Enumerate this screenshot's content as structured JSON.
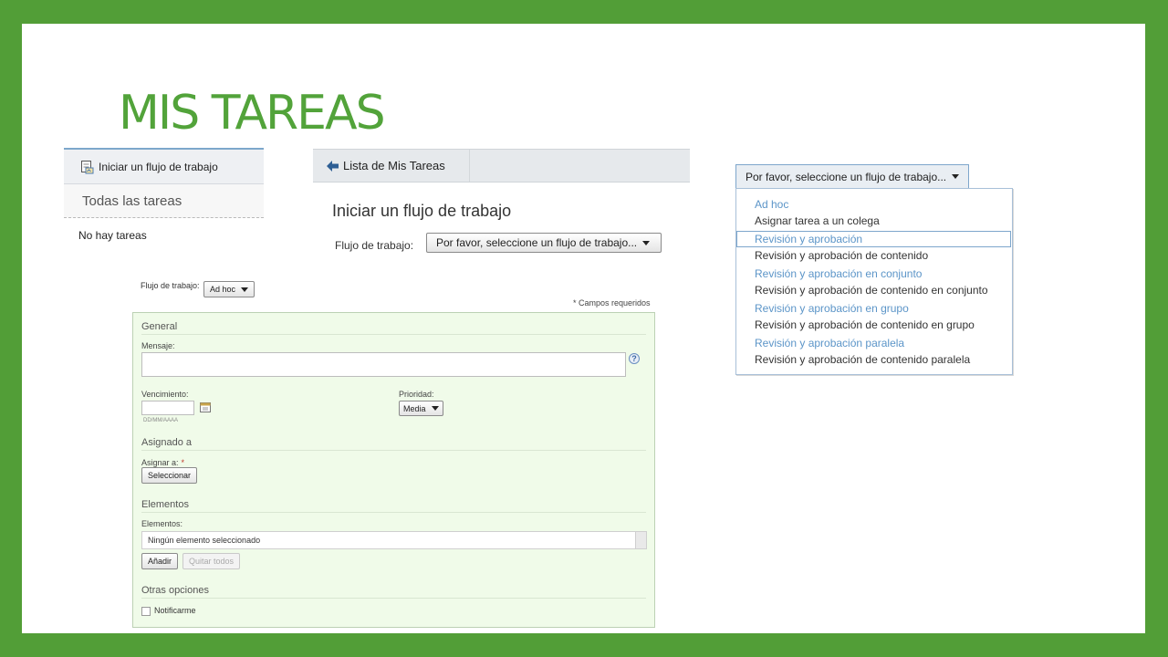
{
  "slide": {
    "title": "MIS TAREAS",
    "background_color": "#529e37",
    "title_color": "#52a33a"
  },
  "tasks_panel": {
    "start_link": "Iniciar un flujo de trabajo",
    "start_icon": "workflow-doc-icon",
    "all_tasks": "Todas las tareas",
    "empty_message": "No hay tareas"
  },
  "start_panel": {
    "back_link": "Lista de Mis Tareas",
    "back_icon": "arrow-left-icon",
    "heading": "Iniciar un flujo de trabajo",
    "workflow_label": "Flujo de trabajo:",
    "workflow_select": "Por favor, seleccione un flujo de trabajo..."
  },
  "workflow_dropdown": {
    "button_label": "Por favor, seleccione un flujo de trabajo...",
    "accent_color": "#5c95c8",
    "options": [
      {
        "title": "Ad hoc",
        "description": "Asignar tarea a un colega"
      },
      {
        "title": "Revisión y aprobación",
        "description": "Revisión y aprobación de contenido"
      },
      {
        "title": "Revisión y aprobación en conjunto",
        "description": "Revisión y aprobación de contenido en conjunto"
      },
      {
        "title": "Revisión y aprobación en grupo",
        "description": "Revisión y aprobación de contenido en grupo"
      },
      {
        "title": "Revisión y aprobación paralela",
        "description": "Revisión y aprobación de contenido paralela"
      }
    ],
    "highlighted_option": "Revisión y aprobación"
  },
  "adhoc_form": {
    "workflow_label": "Flujo de trabajo:",
    "workflow_value": "Ad hoc",
    "required_note": "* Campos requeridos",
    "background_color": "#f0fbe9",
    "general": {
      "heading": "General",
      "message_label": "Mensaje:",
      "help_icon": "help-icon",
      "due_label": "Vencimiento:",
      "due_placeholder": "DD/MM/AAAA",
      "calendar_icon": "calendar-icon",
      "priority_label": "Prioridad:",
      "priority_value": "Media"
    },
    "assigned": {
      "heading": "Asignado a",
      "assign_label": "Asignar a:",
      "required_mark": "*",
      "select_button": "Seleccionar"
    },
    "elements": {
      "heading": "Elementos",
      "elements_label": "Elementos:",
      "empty_value": "Ningún elemento seleccionado",
      "add_button": "Añadir",
      "remove_all_button": "Quitar todos"
    },
    "other": {
      "heading": "Otras opciones",
      "notify_label": "Notificarme"
    }
  }
}
